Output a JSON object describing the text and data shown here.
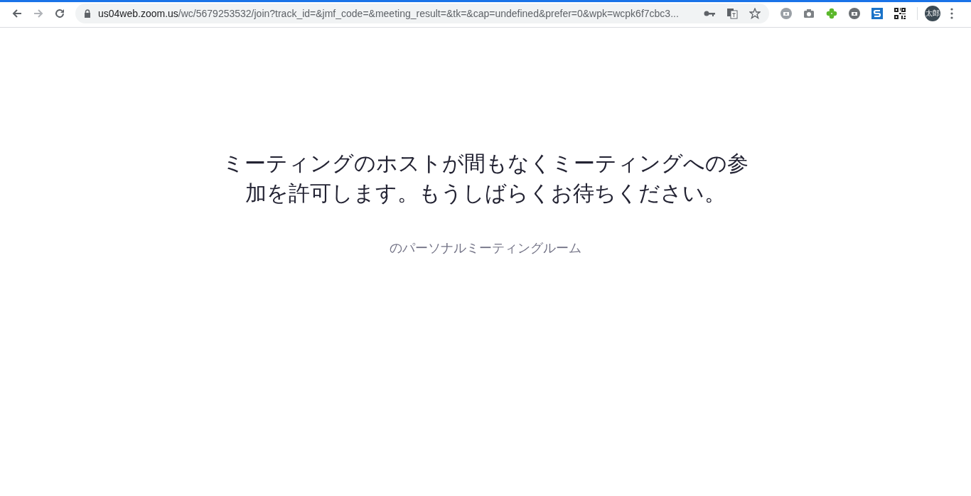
{
  "browser": {
    "loading": true,
    "address": {
      "host": "us04web.zoom.us",
      "path": "/wc/5679253532/join?track_id=&jmf_code=&meeting_result=&tk=&cap=undefined&prefer=0&wpk=wcpk6f7cbc3..."
    },
    "forward_disabled": true,
    "bookmarked": false,
    "profile": "太郎"
  },
  "page": {
    "message": "ミーティングのホストが間もなくミーティングへの参加を許可します。もうしばらくお待ちください。",
    "room": "のパーソナルミーティングルーム"
  }
}
